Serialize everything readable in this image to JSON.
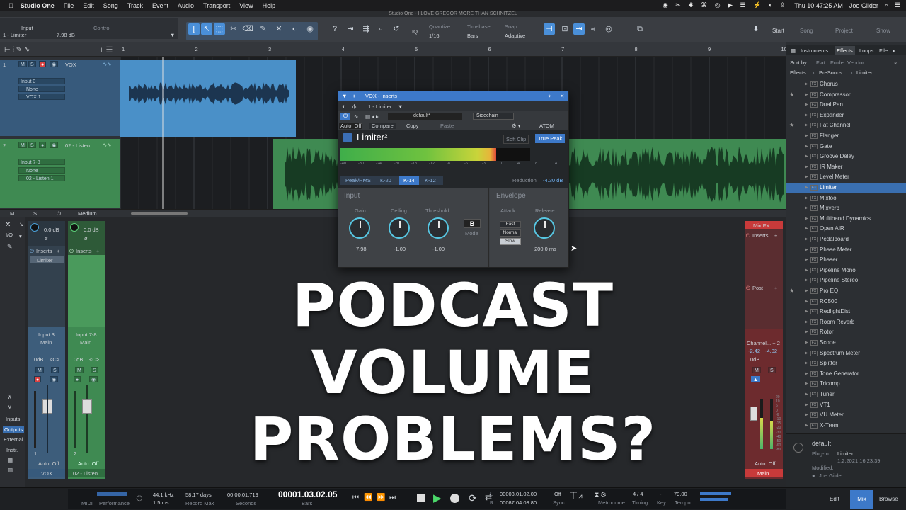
{
  "menubar": {
    "app": "Studio One",
    "menus": [
      "File",
      "Edit",
      "Song",
      "Track",
      "Event",
      "Audio",
      "Transport",
      "View",
      "Help"
    ],
    "window_title": "Studio One - I LOVE GREGOR MORE THAN SCHNITZEL",
    "clock": "Thu 10:47:25 AM",
    "user": "Joe Gilder"
  },
  "toolbar": {
    "input_label": "Input",
    "control_label": "Control",
    "insert_name": "1 - Limiter",
    "input_value": "7.98 dB",
    "quantize_label": "Quantize",
    "quantize_value": "1/16",
    "timebase_label": "Timebase",
    "timebase_value": "Bars",
    "snap_label": "Snap",
    "snap_value": "Adaptive",
    "iq": "IQ",
    "start": "Start",
    "song": "Song",
    "project": "Project",
    "show": "Show"
  },
  "ruler": [
    "1",
    "2",
    "3",
    "4",
    "5",
    "6",
    "7",
    "8",
    "9",
    "10"
  ],
  "tracks": [
    {
      "num": "1",
      "name": "VOX",
      "input": "Input 3",
      "send": "None",
      "output": "VOX 1",
      "color": "#375a7c"
    },
    {
      "num": "2",
      "name": "02 - Listen",
      "input": "Input 7-8",
      "send": "None",
      "output": "02 - Listen 1",
      "color": "#3f8a52"
    }
  ],
  "track_footer": {
    "size": "Medium",
    "m": "M",
    "s": "S"
  },
  "plugin": {
    "window_title": "VOX - Inserts",
    "slot": "1 - Limiter",
    "preset": "default*",
    "sidechain": "Sidechain",
    "auto": "Auto: Off",
    "compare": "Compare",
    "copy": "Copy",
    "paste": "Paste",
    "atom": "ATOM",
    "name": "Limiter²",
    "soft_clip": "Soft Clip",
    "true_peak": "True Peak",
    "meter_scale": [
      "-40",
      "-30",
      "-24",
      "-20",
      "-18",
      "-12",
      "-8",
      "-6",
      "-3",
      "0",
      "4",
      "8",
      "14"
    ],
    "meter_level": 0.82,
    "modes": [
      "Peak/RMS",
      "K-20",
      "K-14",
      "K-12"
    ],
    "reduction_label": "Reduction",
    "reduction_value": "-4.30 dB",
    "input_section": "Input",
    "envelope_section": "Envelope",
    "gain_label": "Gain",
    "gain_value": "7.98",
    "ceiling_label": "Ceiling",
    "ceiling_value": "-1.00",
    "threshold_label": "Threshold",
    "threshold_value": "-1.00",
    "mode_letter": "B",
    "mode_label": "Mode",
    "attack_label": "Attack",
    "attack_options": [
      "Fast",
      "Normal",
      "Slow"
    ],
    "release_label": "Release",
    "release_value": "200.0 ms"
  },
  "mixer": {
    "io": "I/O",
    "strip1": {
      "gain": "0.0 dB",
      "inserts": "Inserts",
      "insert1": "Limiter",
      "input": "Input 3",
      "bus": "Main",
      "vol": "0dB",
      "pan": "<C>",
      "m": "M",
      "s": "S",
      "auto": "Auto: Off",
      "num": "1",
      "name": "VOX"
    },
    "strip2": {
      "gain": "0.0 dB",
      "inserts": "Inserts",
      "input": "Input 7-8",
      "bus": "Main",
      "vol": "0dB",
      "pan": "<C>",
      "m": "M",
      "s": "S",
      "auto": "Auto: Off",
      "num": "2",
      "name": "02 - Listen"
    },
    "master": {
      "mixfx": "Mix FX",
      "inserts": "Inserts",
      "post": "Post",
      "channel": "Channel... + 2",
      "l": "-2.42",
      "r": "-4.02",
      "vol": "0dB",
      "m": "M",
      "s": "S",
      "auto": "Auto: Off",
      "name": "Main",
      "scale": [
        "20",
        "10",
        "6",
        "0",
        "-6",
        "-10",
        "-15",
        "-20",
        "-30",
        "-40",
        "-50",
        "-60",
        "-80"
      ]
    },
    "side_tabs": [
      "Inputs",
      "Outputs",
      "External",
      "Instr."
    ]
  },
  "overlay": {
    "line1": "PODCAST",
    "line2": "VOLUME",
    "line3": "PROBLEMS?"
  },
  "browser": {
    "tabs": [
      "Instruments",
      "Effects",
      "Loops",
      "File"
    ],
    "sort_by": "Sort by:",
    "sort_opts": [
      "Flat",
      "Folder",
      "Vendor"
    ],
    "path": [
      "Effects",
      "PreSonus",
      "Limiter"
    ],
    "items": [
      {
        "name": "Chorus",
        "star": false
      },
      {
        "name": "Compressor",
        "star": true
      },
      {
        "name": "Dual Pan",
        "star": false
      },
      {
        "name": "Expander",
        "star": false
      },
      {
        "name": "Fat Channel",
        "star": true
      },
      {
        "name": "Flanger",
        "star": false
      },
      {
        "name": "Gate",
        "star": false
      },
      {
        "name": "Groove Delay",
        "star": false
      },
      {
        "name": "IR Maker",
        "star": false
      },
      {
        "name": "Level Meter",
        "star": false
      },
      {
        "name": "Limiter",
        "star": false,
        "selected": true
      },
      {
        "name": "Mixtool",
        "star": false
      },
      {
        "name": "Mixverb",
        "star": false
      },
      {
        "name": "Multiband Dynamics",
        "star": false
      },
      {
        "name": "Open AIR",
        "star": false
      },
      {
        "name": "Pedalboard",
        "star": false
      },
      {
        "name": "Phase Meter",
        "star": false
      },
      {
        "name": "Phaser",
        "star": false
      },
      {
        "name": "Pipeline Mono",
        "star": false
      },
      {
        "name": "Pipeline Stereo",
        "star": false
      },
      {
        "name": "Pro EQ",
        "star": true
      },
      {
        "name": "RC500",
        "star": false
      },
      {
        "name": "RedlightDist",
        "star": false
      },
      {
        "name": "Room Reverb",
        "star": false
      },
      {
        "name": "Rotor",
        "star": false
      },
      {
        "name": "Scope",
        "star": false
      },
      {
        "name": "Spectrum Meter",
        "star": false
      },
      {
        "name": "Splitter",
        "star": false
      },
      {
        "name": "Tone Generator",
        "star": false
      },
      {
        "name": "Tricomp",
        "star": false
      },
      {
        "name": "Tuner",
        "star": false
      },
      {
        "name": "VT1",
        "star": false
      },
      {
        "name": "VU Meter",
        "star": false
      },
      {
        "name": "X-Trem",
        "star": false
      }
    ],
    "info": {
      "preset": "default",
      "plugin_label": "Plug-In:",
      "plugin": "Limiter",
      "version": "1.2.2021 16:23:39",
      "modified_label": "Modified:",
      "author": "Joe Gilder"
    }
  },
  "transport": {
    "midi": "MIDI",
    "performance": "Performance",
    "rate": "44.1 kHz",
    "latency": "1.5 ms",
    "days": "58:17 days",
    "record_max": "Record Max",
    "seconds_val": "00:00:01.719",
    "seconds": "Seconds",
    "bars_val": "00001.03.02.05",
    "bars": "Bars",
    "l_label": "L",
    "l_val": "00003.01.02.00",
    "r_label": "R",
    "r_val": "00087.04.03.80",
    "sync_val": "Off",
    "sync": "Sync",
    "metronome": "Metronome",
    "timing_val": "4 / 4",
    "timing": "Timing",
    "key_val": "-",
    "key": "Key",
    "tempo_val": "79.00",
    "tempo": "Tempo",
    "edit": "Edit",
    "mix": "Mix",
    "browse": "Browse"
  }
}
